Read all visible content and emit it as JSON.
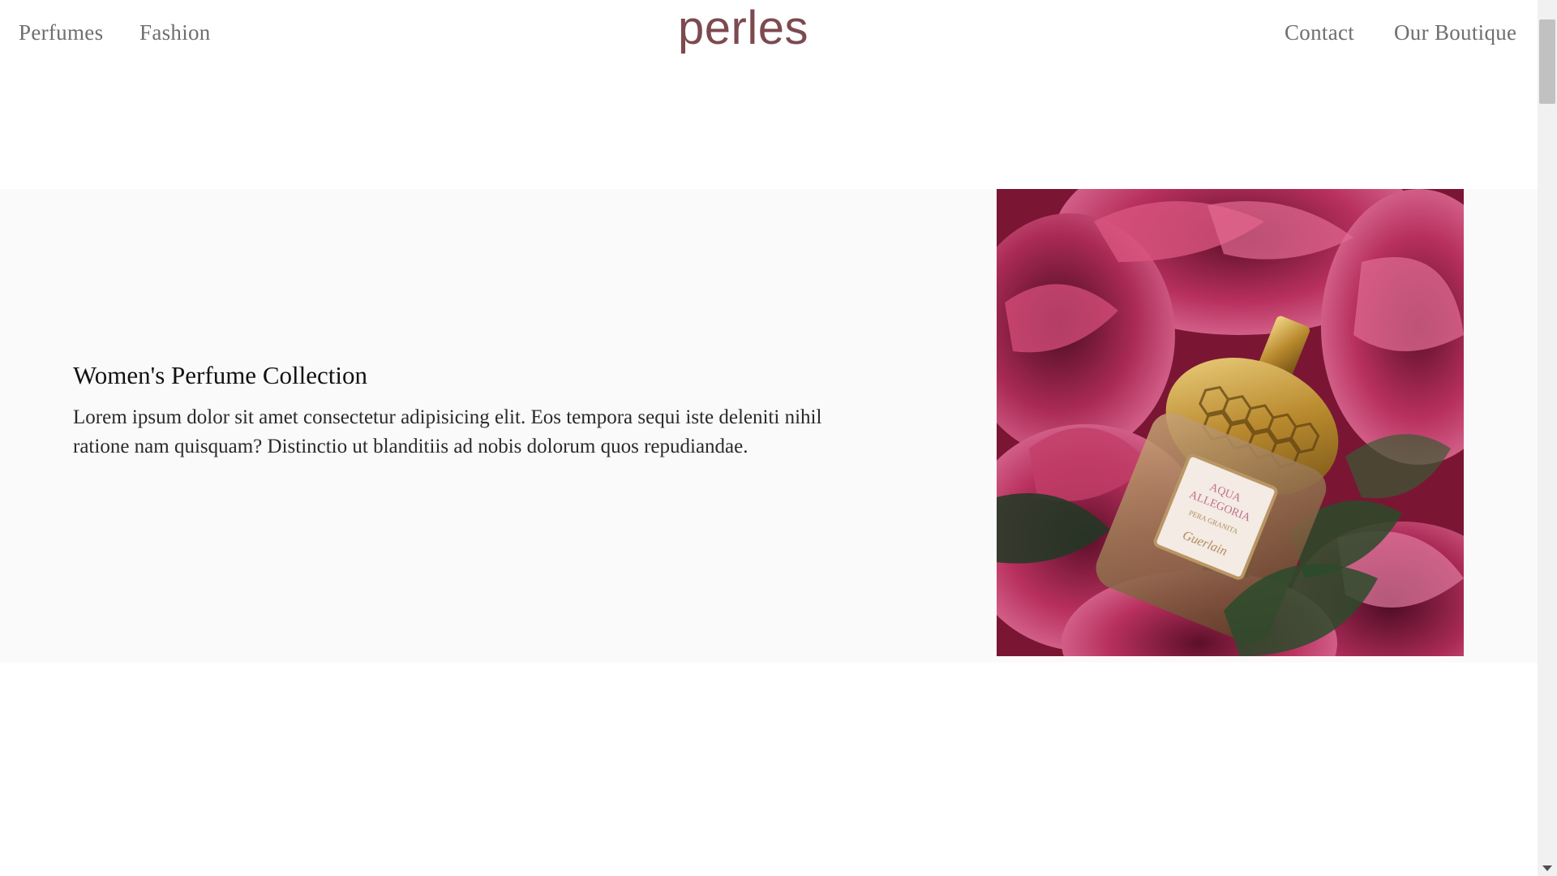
{
  "nav": {
    "left_links": [
      "Perfumes",
      "Fashion"
    ],
    "right_links": [
      "Contact",
      "Our Boutique"
    ],
    "logo": "perles"
  },
  "feature": {
    "title": "Women's Perfume Collection",
    "body": "Lorem ipsum dolor sit amet consectetur adipisicing elit. Eos tempora sequi iste deleniti nihil ratione nam quisquam? Distinctio ut blanditiis ad nobis dolorum quos repudiandae.",
    "image": {
      "label_line1": "AQUA",
      "label_line2": "ALLEGORIA",
      "label_line3": "PERA GRANITA",
      "label_brand": "Guerlain"
    }
  },
  "colors": {
    "logo": "#7c4a4f",
    "nav_text": "#6f6f6f",
    "section_bg": "#fafafa",
    "flower_pink": "#c93b6b"
  }
}
